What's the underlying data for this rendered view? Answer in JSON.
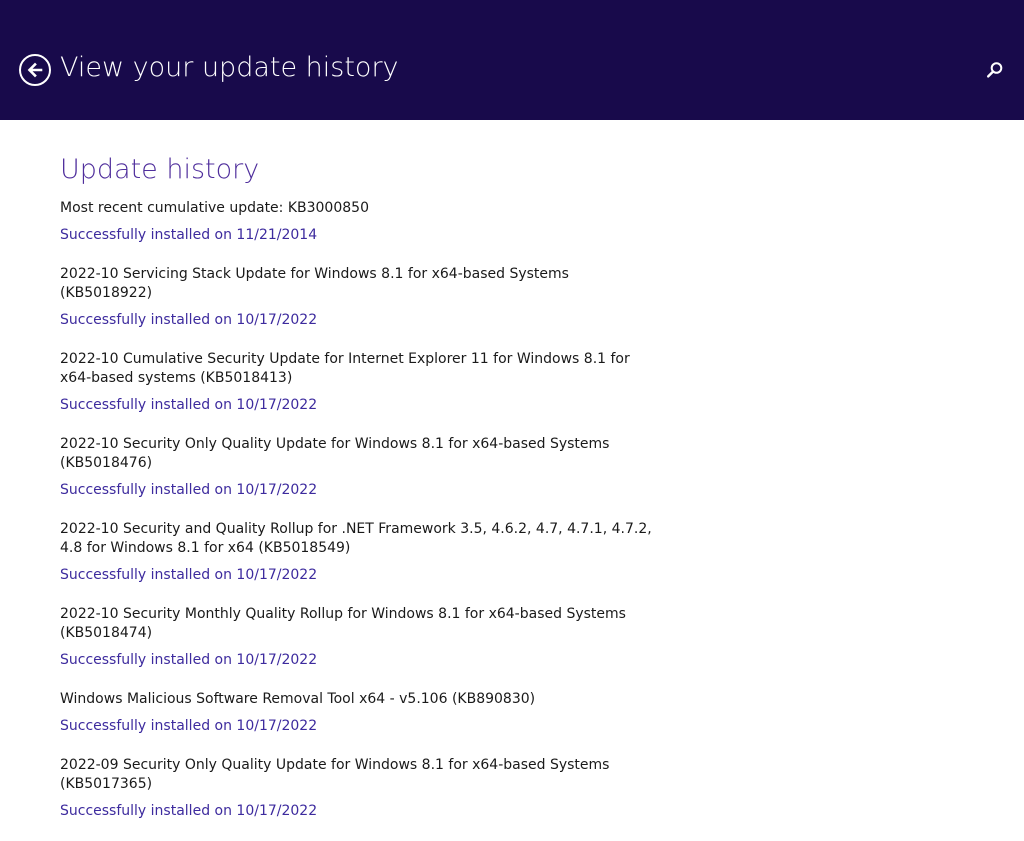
{
  "header": {
    "title": "View your update history",
    "back_icon": "back-arrow-icon",
    "search_icon": "search-icon",
    "background_color": "#180a4b"
  },
  "main": {
    "section_title": "Update history",
    "accent_color": "#4f2e9c",
    "updates": [
      {
        "name": "Most recent cumulative update: KB3000850",
        "status": "Successfully installed on 11/21/2014"
      },
      {
        "name": "2022-10 Servicing Stack Update for Windows 8.1 for x64-based Systems (KB5018922)",
        "status": "Successfully installed on 10/17/2022"
      },
      {
        "name": "2022-10 Cumulative Security Update for Internet Explorer 11 for Windows 8.1 for x64-based systems (KB5018413)",
        "status": "Successfully installed on 10/17/2022"
      },
      {
        "name": "2022-10 Security Only Quality Update for Windows 8.1 for x64-based Systems (KB5018476)",
        "status": "Successfully installed on 10/17/2022"
      },
      {
        "name": "2022-10 Security and Quality Rollup for .NET Framework 3.5, 4.6.2, 4.7, 4.7.1, 4.7.2, 4.8 for Windows 8.1 for x64 (KB5018549)",
        "status": "Successfully installed on 10/17/2022"
      },
      {
        "name": "2022-10 Security Monthly Quality Rollup for Windows 8.1 for x64-based Systems (KB5018474)",
        "status": "Successfully installed on 10/17/2022"
      },
      {
        "name": "Windows Malicious Software Removal Tool x64 - v5.106 (KB890830)",
        "status": "Successfully installed on 10/17/2022"
      },
      {
        "name": "2022-09 Security Only Quality Update for Windows 8.1 for x64-based Systems (KB5017365)",
        "status": "Successfully installed on 10/17/2022"
      }
    ]
  }
}
